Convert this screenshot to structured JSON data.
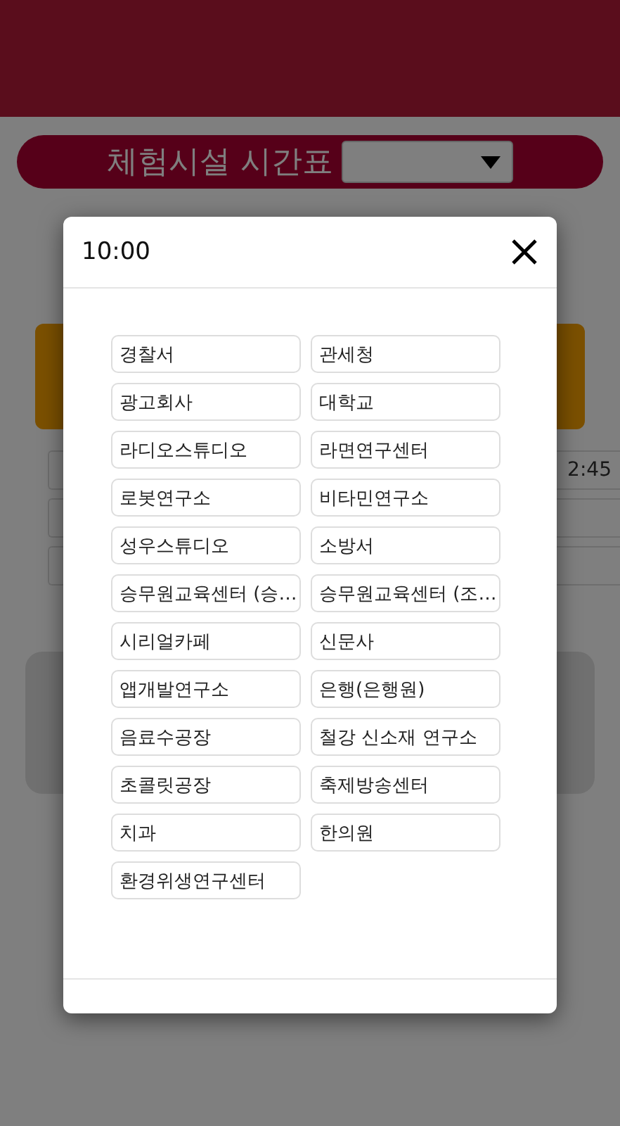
{
  "title_bar": {
    "title": "체험시설 시간표"
  },
  "schedule": {
    "time_cell": "2:45"
  },
  "modal": {
    "title": "10:00",
    "facilities": [
      "경찰서",
      "관세청",
      "광고회사",
      "대학교",
      "라디오스튜디오",
      "라면연구센터",
      "로봇연구소",
      "비타민연구소",
      "성우스튜디오",
      "소방서",
      "승무원교육센터 (승…",
      "승무원교육센터 (조…",
      "시리얼카페",
      "신문사",
      "앱개발연구소",
      "은행(은행원)",
      "음료수공장",
      "철강 신소재 연구소",
      "초콜릿공장",
      "축제방송센터",
      "치과",
      "한의원",
      "환경위생연구센터"
    ]
  }
}
